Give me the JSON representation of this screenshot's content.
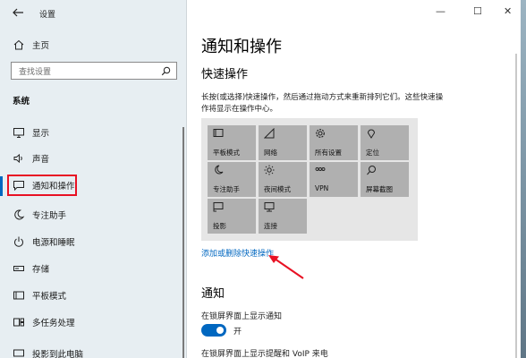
{
  "window": {
    "title": "设置",
    "minimize_glyph": "—",
    "maximize_glyph": "☐",
    "close_glyph": "✕"
  },
  "sidebar": {
    "home_label": "主页",
    "search_placeholder": "查找设置",
    "section_label": "系统",
    "items": [
      {
        "label": "显示",
        "icon": "monitor-icon"
      },
      {
        "label": "声音",
        "icon": "speaker-icon"
      },
      {
        "label": "通知和操作",
        "icon": "message-icon",
        "selected": true
      },
      {
        "label": "专注助手",
        "icon": "moon-icon"
      },
      {
        "label": "电源和睡眠",
        "icon": "power-icon"
      },
      {
        "label": "存储",
        "icon": "storage-icon"
      },
      {
        "label": "平板模式",
        "icon": "tablet-icon"
      },
      {
        "label": "多任务处理",
        "icon": "multitask-icon"
      },
      {
        "label": "投影到此电脑",
        "icon": "projector-icon"
      }
    ],
    "highlight_color": "#e81123"
  },
  "main": {
    "page_title": "通知和操作",
    "quick_actions": {
      "heading": "快速操作",
      "description_line1": "长按(或选择)快速操作，然后通过拖动方式来重新排列它们。这些快速操",
      "description_line2": "作将显示在操作中心。",
      "tiles": [
        {
          "label": "平板模式",
          "icon": "tablet-mode-icon"
        },
        {
          "label": "网络",
          "icon": "network-icon"
        },
        {
          "label": "所有设置",
          "icon": "gear-icon"
        },
        {
          "label": "定位",
          "icon": "location-icon"
        },
        {
          "label": "专注助手",
          "icon": "moon-icon"
        },
        {
          "label": "夜间模式",
          "icon": "brightness-icon"
        },
        {
          "label": "VPN",
          "icon": "vpn-icon"
        },
        {
          "label": "屏幕截图",
          "icon": "snip-icon"
        },
        {
          "label": "投影",
          "icon": "project-icon"
        },
        {
          "label": "连接",
          "icon": "connect-icon"
        }
      ],
      "link_label": "添加或删除快速操作"
    },
    "notifications": {
      "heading": "通知",
      "lock_screen_label": "在锁屏界面上显示通知",
      "toggle_state": "开",
      "toggle_on": true,
      "next_line": "在锁屏界面上显示提醒和 VoIP 来电"
    },
    "accent_color": "#0067c0"
  }
}
